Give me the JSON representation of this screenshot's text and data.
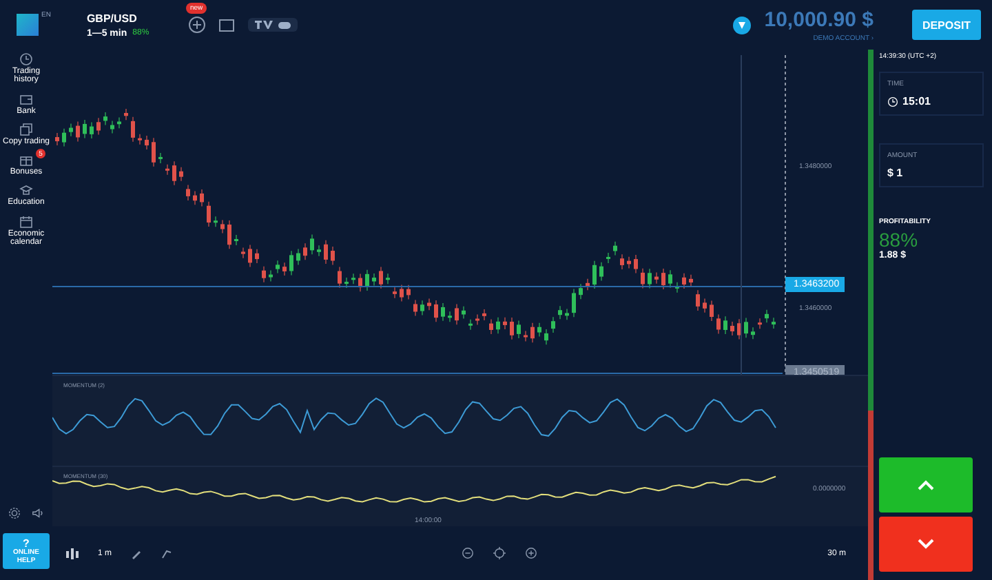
{
  "header": {
    "logo_badge": "EN",
    "pair": "GBP/USD",
    "expiry": "1—5 min",
    "payout": "88%",
    "new_badge": "new",
    "balance": "10,000.90 $",
    "account": "DEMO ACCOUNT ›",
    "deposit": "DEPOSIT"
  },
  "sidebar": {
    "items": [
      {
        "label": "Trading history"
      },
      {
        "label": "Bank"
      },
      {
        "label": "Copy trading"
      },
      {
        "label": "Bonuses",
        "badge": "5"
      },
      {
        "label": "Education"
      },
      {
        "label": "Economic calendar"
      }
    ],
    "help": {
      "mark": "?",
      "label": "ONLINE HELP"
    }
  },
  "chart": {
    "price_labels": [
      "1.3480000",
      "1.3460000"
    ],
    "current_price": "1.3463200",
    "marker_price": "1.3450519",
    "time_label": "14:00:00",
    "indicators": [
      {
        "label": "MOMENTUM (2)",
        "color": "#3d9bd6"
      },
      {
        "label": "MOMENTUM (30)",
        "color": "#e3df7c",
        "reading": "0.0000000"
      }
    ],
    "sentiment": {
      "level": 0.68
    }
  },
  "toolbar": {
    "timeframe": "1 m",
    "range": "30 m"
  },
  "panel": {
    "clock": "14:39:30 (UTC +2)",
    "time": {
      "label": "TIME",
      "value": "15:01"
    },
    "amount": {
      "label": "AMOUNT",
      "value": "$ 1"
    },
    "profitability": {
      "label": "PROFITABILITY",
      "percent": "88%",
      "payout": "1.88 $"
    }
  }
}
